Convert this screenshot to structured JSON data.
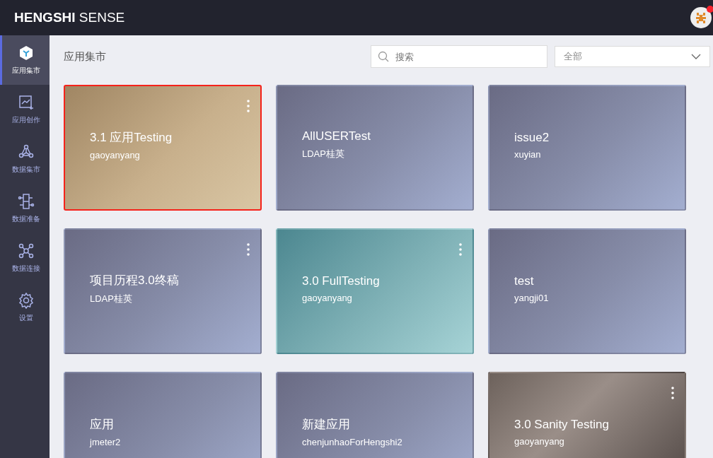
{
  "header": {
    "brand_bold": "HENGSHI",
    "brand_light": "SENSE",
    "notification": true
  },
  "sidebar": {
    "items": [
      {
        "label": "应用集市",
        "kind": "cube",
        "selected": true
      },
      {
        "label": "应用创作",
        "kind": "chart",
        "selected": false
      },
      {
        "label": "数据集市",
        "kind": "hex",
        "selected": false
      },
      {
        "label": "数据准备",
        "kind": "prep",
        "selected": false
      },
      {
        "label": "数据连接",
        "kind": "connect",
        "selected": false
      },
      {
        "label": "设置",
        "kind": "gear",
        "selected": false
      }
    ]
  },
  "page": {
    "title": "应用集市",
    "search": {
      "placeholder": "搜索"
    },
    "filter": {
      "value": "全部"
    }
  },
  "apps": [
    {
      "title": "3.1 应用Testing",
      "owner": "gaoyanyang",
      "kind": "tan",
      "selected": true,
      "menu": true
    },
    {
      "title": "AllUSERTest",
      "owner": "LDAP桂英",
      "kind": "slate",
      "selected": false,
      "menu": false
    },
    {
      "title": "issue2",
      "owner": "xuyian",
      "kind": "slate",
      "selected": false,
      "menu": false
    },
    {
      "title": "项目历程3.0终稿",
      "owner": "LDAP桂英",
      "kind": "slate",
      "selected": false,
      "menu": true
    },
    {
      "title": "3.0 FullTesting",
      "owner": "gaoyanyang",
      "kind": "teal",
      "selected": false,
      "menu": true
    },
    {
      "title": "test",
      "owner": "yangji01",
      "kind": "slate",
      "selected": false,
      "menu": false
    },
    {
      "title": "应用",
      "owner": "jmeter2",
      "kind": "slate",
      "selected": false,
      "menu": false
    },
    {
      "title": "新建应用",
      "owner": "chenjunhaoForHengshi2",
      "kind": "slate",
      "selected": false,
      "menu": false
    },
    {
      "title": "3.0 Sanity Testing",
      "owner": "gaoyanyang",
      "kind": "photo",
      "selected": false,
      "menu": true
    }
  ]
}
